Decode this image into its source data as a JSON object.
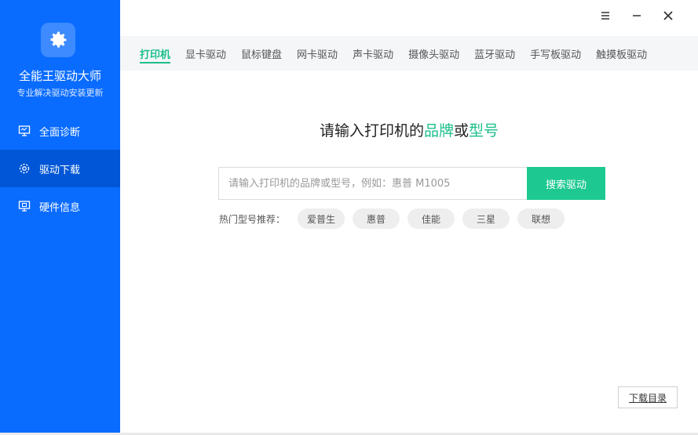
{
  "app": {
    "name": "全能王驱动大师",
    "subtitle": "专业解决驱动安装更新"
  },
  "sidebar": {
    "items": [
      {
        "label": "全面诊断",
        "icon": "monitor-icon",
        "active": false
      },
      {
        "label": "驱动下载",
        "icon": "gear-icon",
        "active": true
      },
      {
        "label": "硬件信息",
        "icon": "hardware-icon",
        "active": false
      }
    ]
  },
  "tabs": [
    {
      "label": "打印机",
      "active": true
    },
    {
      "label": "显卡驱动"
    },
    {
      "label": "鼠标键盘"
    },
    {
      "label": "网卡驱动"
    },
    {
      "label": "声卡驱动"
    },
    {
      "label": "摄像头驱动"
    },
    {
      "label": "蓝牙驱动"
    },
    {
      "label": "手写板驱动"
    },
    {
      "label": "触摸板驱动"
    }
  ],
  "main": {
    "heading_prefix": "请输入打印机的",
    "heading_brand": "品牌",
    "heading_or": "或",
    "heading_model": "型号",
    "search_placeholder": "请输入打印机的品牌或型号，例如：惠普 M1005",
    "search_value": "",
    "search_button": "搜索驱动",
    "hot_label": "热门型号推荐：",
    "hot_items": [
      "爱普生",
      "惠普",
      "佳能",
      "三星",
      "联想"
    ],
    "download_dir": "下载目录"
  },
  "colors": {
    "sidebar_bg": "#0a6cff",
    "sidebar_active": "#0056d6",
    "accent_green": "#1bbf8b"
  }
}
